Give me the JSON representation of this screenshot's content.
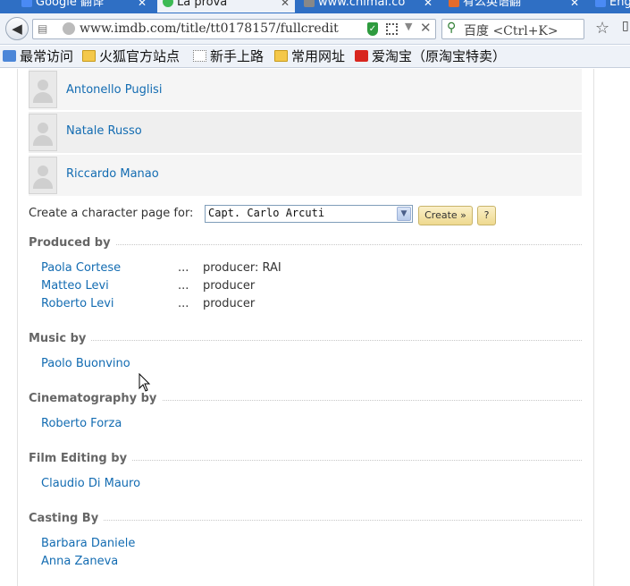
{
  "tabs": [
    {
      "label": "Google 翻译",
      "favicon_color": "#4a8af4"
    },
    {
      "label": "La prova",
      "favicon_color": "#3cba54"
    },
    {
      "label": "www.chimai.co",
      "favicon_color": "#888888"
    },
    {
      "label": "有么英语翻",
      "favicon_color": "#e46b2b"
    },
    {
      "label": "Eng",
      "favicon_color": "#4a8af4"
    }
  ],
  "navbar": {
    "url": "www.imdb.com/title/tt0178157/fullcredit",
    "search_text": "百度 <Ctrl+K>"
  },
  "bookmarks": [
    {
      "label": "最常访问",
      "icon": "star-folder-icon"
    },
    {
      "label": "火狐官方站点",
      "icon": "folder-icon"
    },
    {
      "label": "新手上路",
      "icon": "page-icon"
    },
    {
      "label": "常用网址",
      "icon": "folder-icon"
    },
    {
      "label": "爱淘宝（原淘宝特卖）",
      "icon": "taobao-icon"
    }
  ],
  "cast": [
    {
      "name": "Antonello Puglisi"
    },
    {
      "name": "Natale Russo"
    },
    {
      "name": "Riccardo Manao"
    }
  ],
  "character_page": {
    "label": "Create a character page for:",
    "selected": "Capt. Carlo Arcuti",
    "create_button": "Create »",
    "help_button": "?"
  },
  "produced_by": {
    "title": "Produced by",
    "credits": [
      {
        "name": "Paola Cortese",
        "dots": "...",
        "role": "producer: RAI"
      },
      {
        "name": "Matteo Levi",
        "dots": "...",
        "role": "producer"
      },
      {
        "name": "Roberto Levi",
        "dots": "...",
        "role": "producer"
      }
    ]
  },
  "music_by": {
    "title": "Music by",
    "credits": [
      {
        "name": "Paolo Buonvino"
      }
    ]
  },
  "cinematography_by": {
    "title": "Cinematography by",
    "credits": [
      {
        "name": "Roberto Forza"
      }
    ]
  },
  "film_editing_by": {
    "title": "Film Editing by",
    "credits": [
      {
        "name": "Claudio Di Mauro"
      }
    ]
  },
  "casting_by": {
    "title": "Casting By",
    "credits": [
      {
        "name": "Barbara Daniele"
      },
      {
        "name": "Anna Zaneva"
      }
    ]
  },
  "colors": {
    "link": "#136cb2",
    "section_title": "#666666",
    "tab_strip": "#2f6fc4"
  }
}
